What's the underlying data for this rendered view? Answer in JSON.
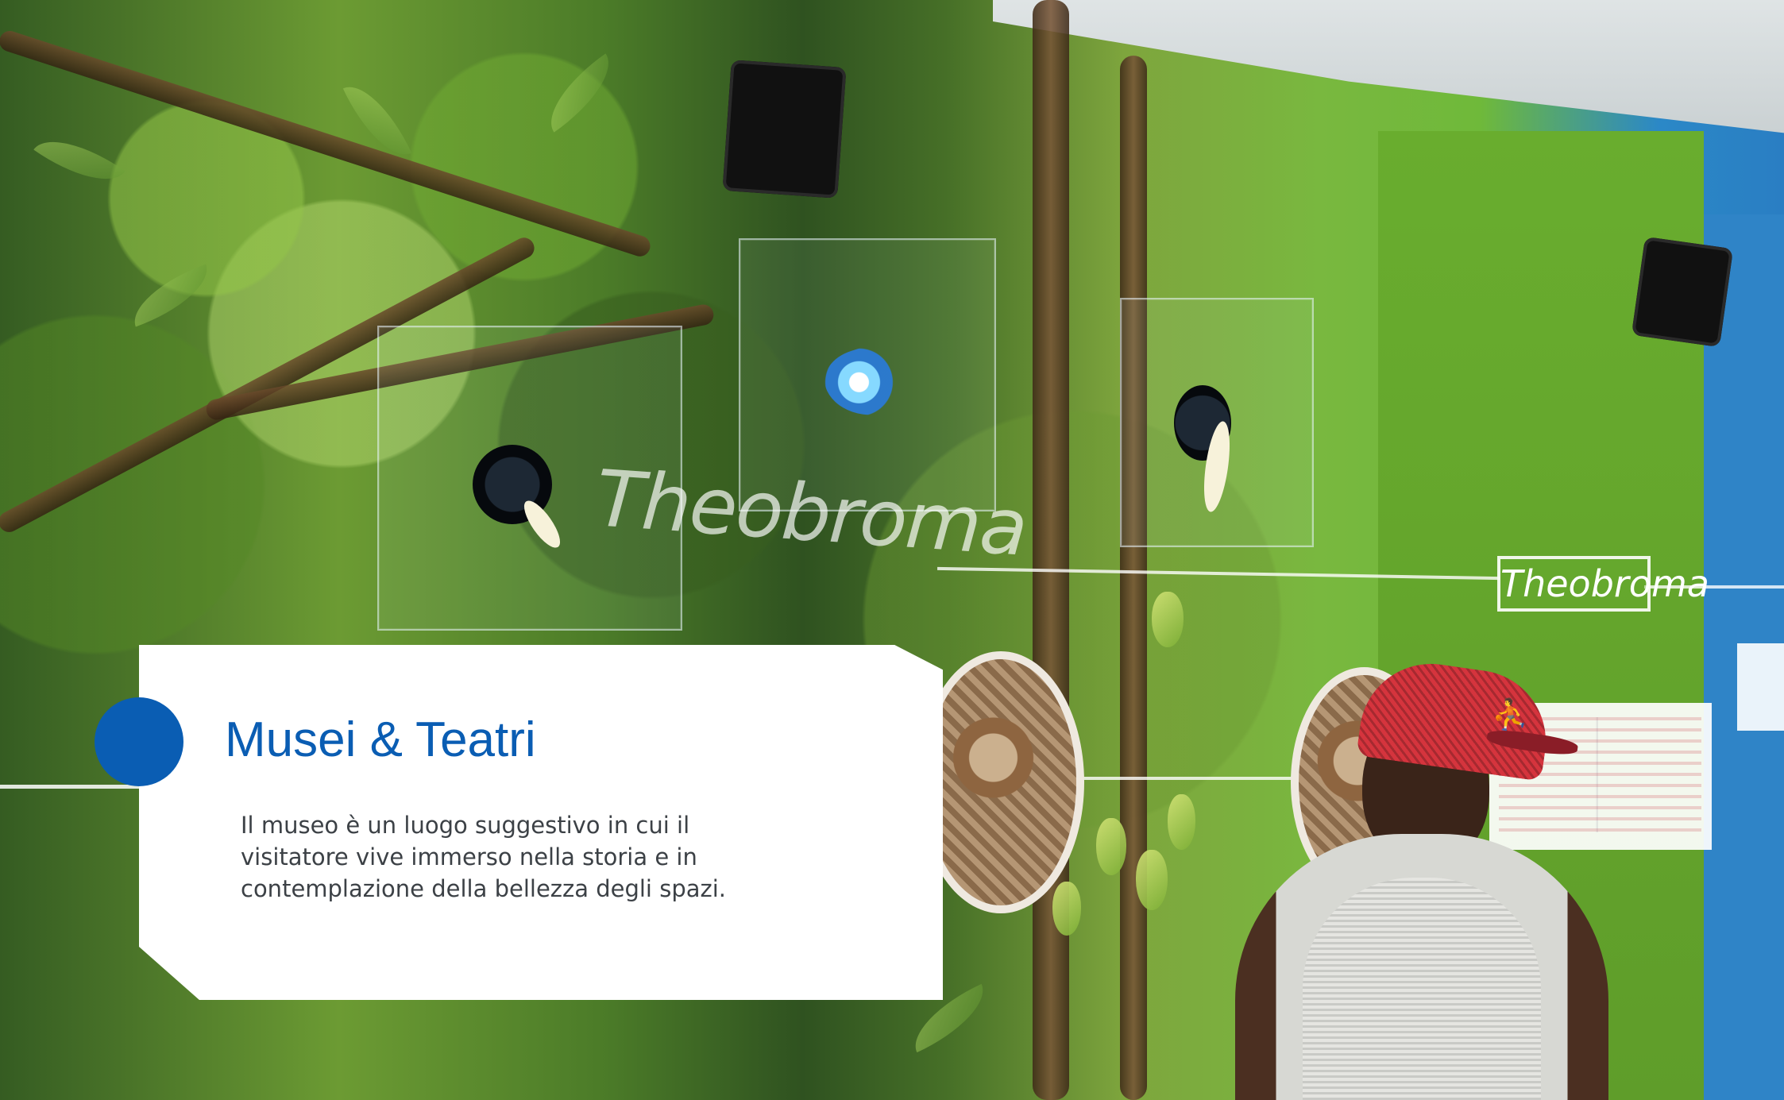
{
  "hero": {
    "background_scene": "museum-exhibit-photo",
    "card": {
      "title": "Musei & Teatri",
      "description": "Il museo è un luogo suggestivo in cui il visitatore vive immerso nella storia e in contemplazione della bellezza degli spazi."
    },
    "exhibit_labels": {
      "glass_word": "Theobroma",
      "wall_title": "Theobroma"
    },
    "icons": {
      "accent_dot": "blue-circle-icon",
      "cap_logo": "jumpman-logo-icon"
    },
    "colors": {
      "accent": "#0a5db3",
      "card_background": "#ffffff",
      "body_text": "#3c4146",
      "green_wall": "#69ad2e",
      "blue_wall": "#2f84c7"
    }
  }
}
